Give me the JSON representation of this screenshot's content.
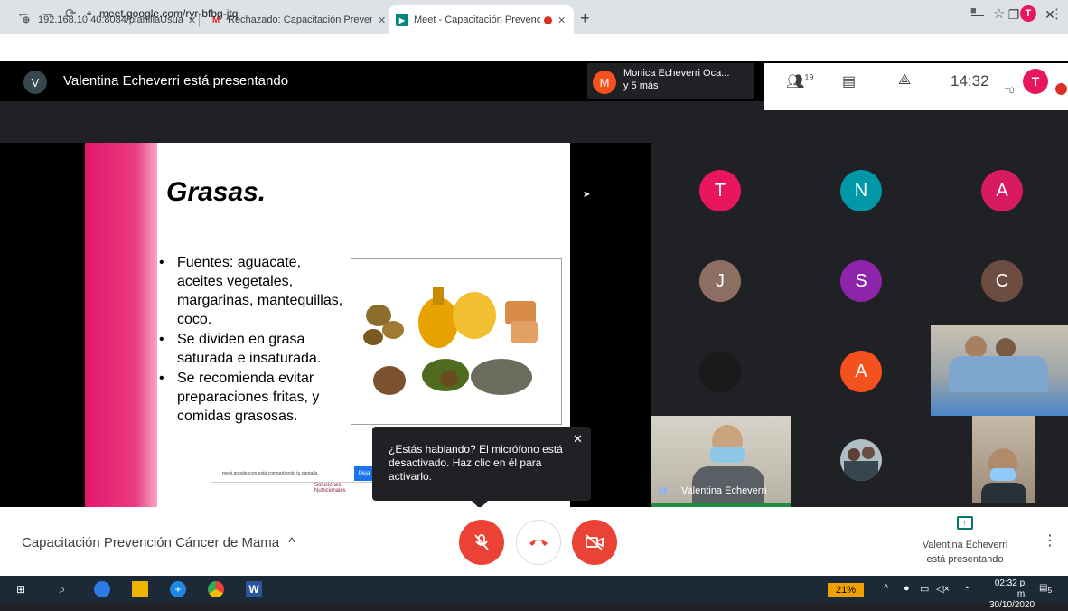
{
  "browser": {
    "tabs": [
      {
        "title": "192.168.10.40:8084/planillaUsuar",
        "close": "✕"
      },
      {
        "title": "Rechazado: Capacitación Prevenc",
        "close": "✕"
      },
      {
        "title": "Meet - Capacitación Prevenc",
        "close": "✕"
      }
    ],
    "new_tab": "+",
    "window_controls": {
      "minimize": "—",
      "restore": "❐",
      "close": "✕"
    },
    "url": "meet.google.com/ryr-bfbg-jtq",
    "profile_initial": "T"
  },
  "meet": {
    "presenter_initial": "V",
    "presenting_text": "Valentina Echeverri está presentando",
    "active_speaker": {
      "initial": "M",
      "name": "Monica Echeverri Oca...",
      "more": "y 5 más"
    },
    "participants_count": "19",
    "time": "14:32",
    "self_label": "TÚ",
    "self_initial": "T"
  },
  "slide": {
    "title": "Grasas.",
    "bullets": [
      "Fuentes: aguacate, aceites vegetales, margarinas, mantequillas, coco.",
      "Se dividen en grasa saturada e insaturada.",
      "Se recomienda evitar preparaciones fritas, y comidas grasosas."
    ],
    "share_note": "meet.google.com está compartiendo tu pantalla.",
    "share_button": "Deja",
    "logo_line1": "Soluciones",
    "logo_line2": "Nutricionales"
  },
  "tooltip": {
    "text": "¿Estás hablando? El micrófono está desactivado. Haz clic en él para activarlo.",
    "close": "✕"
  },
  "participants": [
    {
      "initial": "T",
      "color": "#e8175d"
    },
    {
      "initial": "N",
      "color": "#0097a7"
    },
    {
      "initial": "A",
      "color": "#d81b60"
    },
    {
      "initial": "J",
      "color": "#8d6e63"
    },
    {
      "initial": "S",
      "color": "#8e24aa"
    },
    {
      "initial": "C",
      "color": "#6d4c41"
    },
    {
      "initial": "A",
      "color": "#f4511e"
    }
  ],
  "video_tile_name": "Valentina Echeverri",
  "bottom": {
    "meeting_title": "Capacitación Prevención Cáncer de Mama",
    "present_line1": "Valentina Echeverri",
    "present_line2": "está presentando"
  },
  "taskbar": {
    "battery": "21%",
    "time": "02:32 p. m.",
    "date": "30/10/2020",
    "notifications": "5"
  },
  "colors": {
    "accent_red": "#ea4335",
    "brand_pink": "#e3166a",
    "speaking_green": "#1e8e3e"
  }
}
